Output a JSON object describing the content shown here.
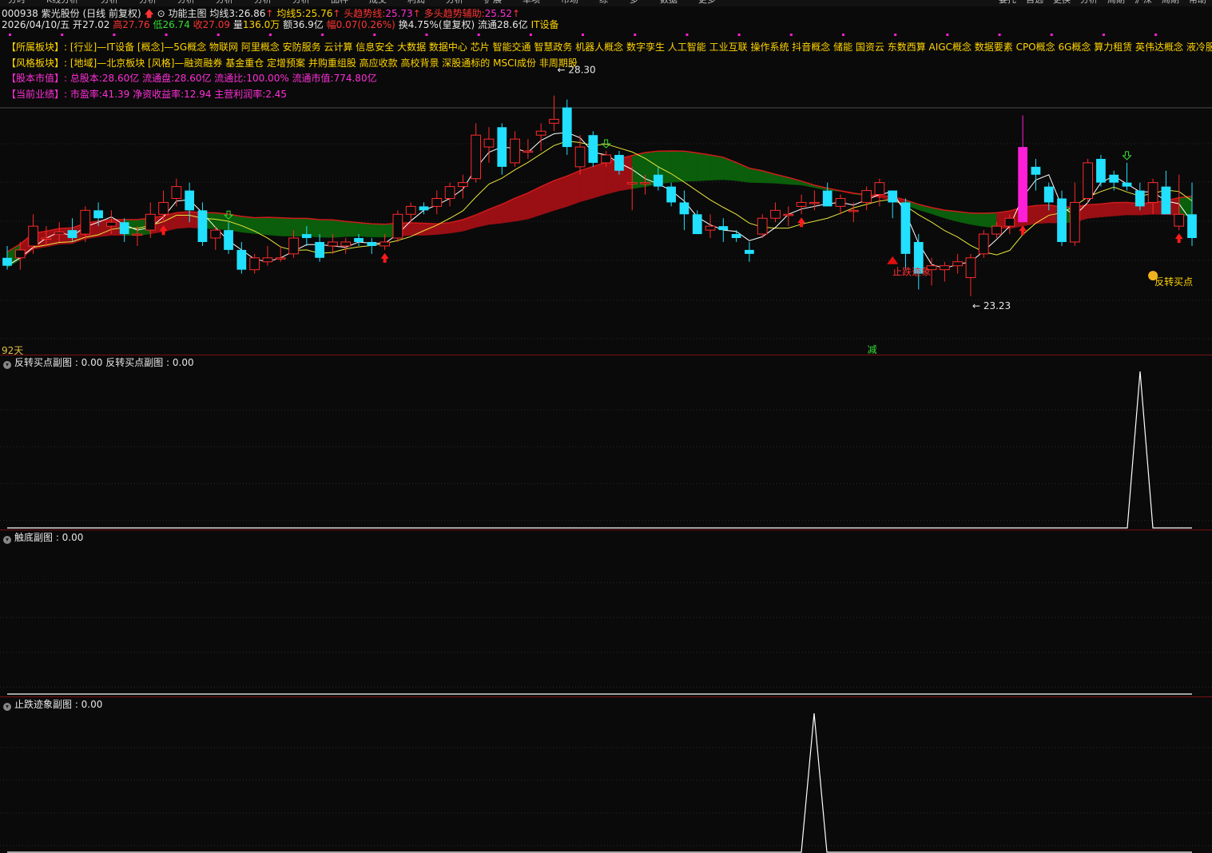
{
  "toolbar": {
    "left_tabs": [
      "分时",
      "K线分析",
      "分析",
      "分析",
      "分析",
      "分析",
      "分析",
      "分析",
      "品种",
      "成交",
      "利润",
      "分析",
      "扩展",
      "单项",
      "市场",
      "综",
      "多",
      "数据",
      "更多"
    ],
    "right_tabs": [
      "委托",
      "自选",
      "更换",
      "分析",
      "周期",
      "沪深",
      "周期",
      "帮助"
    ]
  },
  "header": {
    "code": "000938",
    "name": "紫光股份",
    "period": "(日线 前复权)",
    "indicator": "功能主图",
    "ma3_label": "均线3:",
    "ma3_value": "26.86",
    "ma5_label": "均线5:",
    "ma5_value": "25.76",
    "trend_label": "头趋势线:",
    "trend_value": "25.73",
    "aux_label": "多头趋势辅助:",
    "aux_value": "25.52"
  },
  "quote": {
    "date": "2026/04/10/五",
    "open_label": "开",
    "open": "27.02",
    "high_label": "高",
    "high": "27.76",
    "low_label": "低",
    "low": "26.74",
    "close_label": "收",
    "close": "27.09",
    "vol_label": "量",
    "vol": "136.0万",
    "amount_label": "额",
    "amount": "36.9亿",
    "change_label": "幅",
    "change": "0.07(0.26%)",
    "turnover_label": "换",
    "turnover": "4.75%(皇复权)",
    "float_label": "流通",
    "float": "28.6亿",
    "sector": "IT设备"
  },
  "info": {
    "row1_label": "【所属板块】:",
    "row1_text": "[行业]—IT设备 [概念]—5G概念 物联网 阿里概念 安防服务 云计算 信息安全 大数据 数据中心 芯片 智能交通 智慧政务 机器人概念 数字孪生 人工智能 工业互联 操作系统 抖音概念 储能 国资云 东数西算 AIGC概念 数据要素 CPO概念 6G概念 算力租赁 英伟达概念 液冷服务器",
    "row2_label": "【风格板块】:",
    "row2_text": "[地域]—北京板块 [风格]—融资融券 基金重仓 定增预案 并购重组股 高应收款 高校背景 深股通标的 MSCI成份 非周期股",
    "row3_label": "【股本市值】:",
    "row3_text": "总股本:28.60亿 流通盘:28.60亿 流通比:100.00% 流通市值:774.80亿",
    "row4_label": "【当前业绩】:",
    "row4_text": "市盈率:41.39 净资收益率:12.94 主营利润率:2.45"
  },
  "annotations": {
    "high_price": "28.30",
    "low_price": "23.23",
    "stop_fall": "止跌迹象",
    "reverse_buy": "反转买点",
    "reduce": "减",
    "days": "92天"
  },
  "panels": {
    "p1_title": "反转买点副图 : 0.00  反转买点副图 : 0.00",
    "p2_title": "触底副图 : 0.00",
    "p3_title": "止跌迹象副图 : 0.00"
  },
  "colors": {
    "up": "#ff2a2a",
    "down": "#22e0ff",
    "band_green": "#0b5e0b",
    "band_red": "#9a0f14",
    "ma_white": "#ffffff",
    "ma_yellow": "#e6e63c",
    "magenta": "#ff1fd8"
  },
  "chart_data": {
    "type": "candlestick",
    "title": "",
    "ylim": [
      22.4,
      29.1
    ],
    "candles": [
      {
        "o": 24.2,
        "h": 24.5,
        "l": 23.9,
        "c": 24.0
      },
      {
        "o": 24.2,
        "h": 24.6,
        "l": 23.9,
        "c": 24.4
      },
      {
        "o": 24.5,
        "h": 25.3,
        "l": 24.3,
        "c": 25.0
      },
      {
        "o": 24.7,
        "h": 25.0,
        "l": 24.5,
        "c": 24.7
      },
      {
        "o": 24.8,
        "h": 25.1,
        "l": 24.6,
        "c": 24.85
      },
      {
        "o": 24.9,
        "h": 25.2,
        "l": 24.6,
        "c": 24.7
      },
      {
        "o": 24.8,
        "h": 25.5,
        "l": 24.6,
        "c": 25.4
      },
      {
        "o": 25.4,
        "h": 25.6,
        "l": 25.0,
        "c": 25.2
      },
      {
        "o": 25.0,
        "h": 25.4,
        "l": 24.8,
        "c": 25.1
      },
      {
        "o": 25.1,
        "h": 25.2,
        "l": 24.6,
        "c": 24.8
      },
      {
        "o": 24.8,
        "h": 25.0,
        "l": 24.5,
        "c": 24.8
      },
      {
        "o": 24.9,
        "h": 25.6,
        "l": 24.7,
        "c": 25.3
      },
      {
        "o": 25.3,
        "h": 25.9,
        "l": 25.1,
        "c": 25.6
      },
      {
        "o": 25.7,
        "h": 26.2,
        "l": 25.5,
        "c": 26.0
      },
      {
        "o": 25.9,
        "h": 26.1,
        "l": 25.1,
        "c": 25.4
      },
      {
        "o": 25.4,
        "h": 25.6,
        "l": 24.5,
        "c": 24.6
      },
      {
        "o": 24.7,
        "h": 25.0,
        "l": 24.4,
        "c": 24.9
      },
      {
        "o": 24.9,
        "h": 25.1,
        "l": 24.3,
        "c": 24.4
      },
      {
        "o": 24.4,
        "h": 24.6,
        "l": 23.8,
        "c": 23.9
      },
      {
        "o": 23.9,
        "h": 24.3,
        "l": 23.8,
        "c": 24.2
      },
      {
        "o": 24.1,
        "h": 24.5,
        "l": 24.0,
        "c": 24.2
      },
      {
        "o": 24.2,
        "h": 24.5,
        "l": 24.1,
        "c": 24.2
      },
      {
        "o": 24.3,
        "h": 24.9,
        "l": 24.2,
        "c": 24.7
      },
      {
        "o": 24.8,
        "h": 25.0,
        "l": 24.5,
        "c": 24.7
      },
      {
        "o": 24.6,
        "h": 24.8,
        "l": 24.1,
        "c": 24.2
      },
      {
        "o": 24.5,
        "h": 24.8,
        "l": 24.3,
        "c": 24.6
      },
      {
        "o": 24.5,
        "h": 24.7,
        "l": 24.3,
        "c": 24.6
      },
      {
        "o": 24.7,
        "h": 24.8,
        "l": 24.5,
        "c": 24.6
      },
      {
        "o": 24.6,
        "h": 24.7,
        "l": 24.3,
        "c": 24.5
      },
      {
        "o": 24.5,
        "h": 24.8,
        "l": 24.4,
        "c": 24.6
      },
      {
        "o": 24.7,
        "h": 25.4,
        "l": 24.6,
        "c": 25.3
      },
      {
        "o": 25.3,
        "h": 25.6,
        "l": 25.1,
        "c": 25.5
      },
      {
        "o": 25.5,
        "h": 25.6,
        "l": 25.3,
        "c": 25.4
      },
      {
        "o": 25.5,
        "h": 25.9,
        "l": 25.3,
        "c": 25.7
      },
      {
        "o": 25.7,
        "h": 26.1,
        "l": 25.5,
        "c": 26.0
      },
      {
        "o": 26.0,
        "h": 26.3,
        "l": 25.7,
        "c": 26.1
      },
      {
        "o": 26.2,
        "h": 27.6,
        "l": 26.1,
        "c": 27.3
      },
      {
        "o": 27.0,
        "h": 27.5,
        "l": 26.6,
        "c": 27.2
      },
      {
        "o": 27.5,
        "h": 27.6,
        "l": 26.3,
        "c": 26.5
      },
      {
        "o": 26.6,
        "h": 27.4,
        "l": 26.5,
        "c": 27.2
      },
      {
        "o": 26.9,
        "h": 27.2,
        "l": 26.7,
        "c": 26.9
      },
      {
        "o": 27.3,
        "h": 27.6,
        "l": 26.9,
        "c": 27.4
      },
      {
        "o": 27.6,
        "h": 28.3,
        "l": 27.4,
        "c": 27.7
      },
      {
        "o": 28.0,
        "h": 28.2,
        "l": 26.8,
        "c": 27.0
      },
      {
        "o": 26.5,
        "h": 27.3,
        "l": 26.3,
        "c": 27.0
      },
      {
        "o": 27.3,
        "h": 27.4,
        "l": 26.5,
        "c": 26.6
      },
      {
        "o": 26.6,
        "h": 26.9,
        "l": 26.5,
        "c": 26.8
      },
      {
        "o": 26.8,
        "h": 26.9,
        "l": 26.3,
        "c": 26.4
      },
      {
        "o": 26.1,
        "h": 26.5,
        "l": 25.4,
        "c": 26.1
      },
      {
        "o": 26.1,
        "h": 26.3,
        "l": 25.8,
        "c": 26.1
      },
      {
        "o": 26.3,
        "h": 26.5,
        "l": 25.9,
        "c": 26.0
      },
      {
        "o": 26.0,
        "h": 26.1,
        "l": 25.5,
        "c": 25.6
      },
      {
        "o": 25.6,
        "h": 25.9,
        "l": 24.9,
        "c": 25.3
      },
      {
        "o": 25.3,
        "h": 25.4,
        "l": 24.8,
        "c": 24.8
      },
      {
        "o": 24.9,
        "h": 25.3,
        "l": 24.7,
        "c": 25.0
      },
      {
        "o": 25.0,
        "h": 25.2,
        "l": 24.6,
        "c": 24.9
      },
      {
        "o": 24.8,
        "h": 24.9,
        "l": 24.6,
        "c": 24.7
      },
      {
        "o": 24.4,
        "h": 24.6,
        "l": 24.1,
        "c": 24.3
      },
      {
        "o": 24.8,
        "h": 25.3,
        "l": 24.7,
        "c": 25.2
      },
      {
        "o": 25.2,
        "h": 25.6,
        "l": 25.1,
        "c": 25.4
      },
      {
        "o": 25.3,
        "h": 25.5,
        "l": 25.0,
        "c": 25.3
      },
      {
        "o": 25.5,
        "h": 25.8,
        "l": 25.3,
        "c": 25.6
      },
      {
        "o": 25.6,
        "h": 25.9,
        "l": 25.4,
        "c": 25.6
      },
      {
        "o": 25.9,
        "h": 26.1,
        "l": 25.6,
        "c": 25.5
      },
      {
        "o": 25.5,
        "h": 25.8,
        "l": 25.3,
        "c": 25.7
      },
      {
        "o": 25.4,
        "h": 25.6,
        "l": 25.1,
        "c": 25.4
      },
      {
        "o": 25.6,
        "h": 26.0,
        "l": 25.4,
        "c": 25.9
      },
      {
        "o": 25.8,
        "h": 26.2,
        "l": 25.5,
        "c": 26.1
      },
      {
        "o": 25.9,
        "h": 25.9,
        "l": 25.2,
        "c": 25.6
      },
      {
        "o": 25.6,
        "h": 25.7,
        "l": 23.9,
        "c": 24.3
      },
      {
        "o": 24.6,
        "h": 24.8,
        "l": 23.4,
        "c": 23.8
      },
      {
        "o": 23.9,
        "h": 24.2,
        "l": 23.5,
        "c": 24.0
      },
      {
        "o": 23.9,
        "h": 24.1,
        "l": 23.6,
        "c": 24.0
      },
      {
        "o": 24.0,
        "h": 24.3,
        "l": 23.8,
        "c": 24.1
      },
      {
        "o": 23.7,
        "h": 24.3,
        "l": 23.23,
        "c": 24.2
      },
      {
        "o": 24.3,
        "h": 24.9,
        "l": 24.2,
        "c": 24.8
      },
      {
        "o": 24.8,
        "h": 25.1,
        "l": 24.7,
        "c": 25.0
      },
      {
        "o": 25.0,
        "h": 25.3,
        "l": 24.8,
        "c": 25.2
      },
      {
        "o": 25.1,
        "h": 27.8,
        "l": 25.1,
        "c": 27.0
      },
      {
        "o": 26.5,
        "h": 26.7,
        "l": 25.9,
        "c": 26.3
      },
      {
        "o": 26.0,
        "h": 26.1,
        "l": 25.4,
        "c": 25.6
      },
      {
        "o": 25.7,
        "h": 25.9,
        "l": 24.5,
        "c": 24.6
      },
      {
        "o": 24.6,
        "h": 26.1,
        "l": 24.5,
        "c": 25.6
      },
      {
        "o": 25.7,
        "h": 26.7,
        "l": 25.6,
        "c": 26.6
      },
      {
        "o": 26.7,
        "h": 26.8,
        "l": 26.0,
        "c": 26.1
      },
      {
        "o": 26.3,
        "h": 26.4,
        "l": 25.9,
        "c": 26.1
      },
      {
        "o": 26.1,
        "h": 26.6,
        "l": 25.9,
        "c": 26.0
      },
      {
        "o": 25.9,
        "h": 26.1,
        "l": 25.4,
        "c": 25.5
      },
      {
        "o": 25.6,
        "h": 26.2,
        "l": 25.3,
        "c": 26.1
      },
      {
        "o": 26.0,
        "h": 26.4,
        "l": 25.4,
        "c": 25.3
      },
      {
        "o": 25.0,
        "h": 26.3,
        "l": 24.9,
        "c": 25.3
      },
      {
        "o": 25.3,
        "h": 26.1,
        "l": 24.5,
        "c": 24.7
      }
    ]
  }
}
